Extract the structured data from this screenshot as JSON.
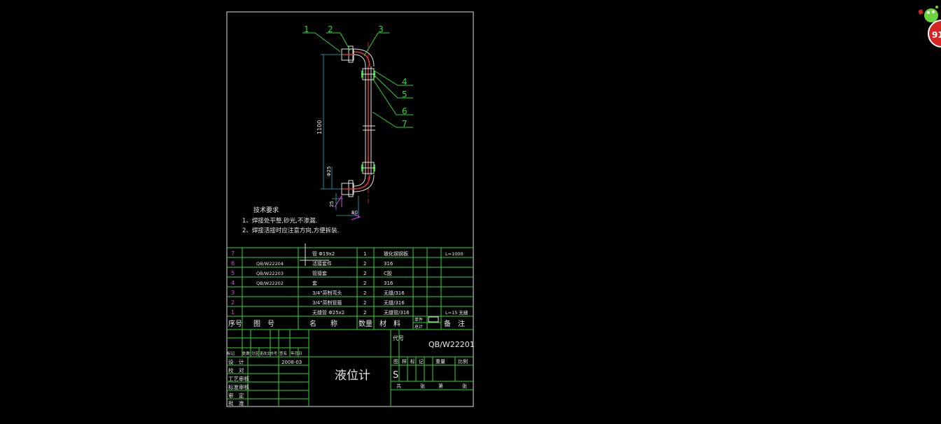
{
  "notes": {
    "title": "技术要求",
    "line1": "1、焊接处平整,砂光,不渗漏.",
    "line2": "2、焊接活接时应注意方向,方便拆装."
  },
  "callouts": [
    "1",
    "2",
    "3",
    "4",
    "5",
    "6",
    "7"
  ],
  "dims": {
    "height": "1100",
    "pipe_dia": "Φ25",
    "small": "25",
    "offset": "80"
  },
  "parts": [
    {
      "no": "7",
      "code": "",
      "name": "管 Φ19x2",
      "qty": "1",
      "material": "玻化钢钢板",
      "remark": "L=1000"
    },
    {
      "no": "6",
      "code": "QB/W22204",
      "name": "活接套件",
      "qty": "2",
      "material": "316",
      "remark": ""
    },
    {
      "no": "5",
      "code": "QB/W22203",
      "name": "管接套",
      "qty": "2",
      "material": "C胶",
      "remark": ""
    },
    {
      "no": "4",
      "code": "QB/W22202",
      "name": "套",
      "qty": "2",
      "material": "316",
      "remark": ""
    },
    {
      "no": "3",
      "code": "",
      "name": "3/4\"英制弯头",
      "qty": "2",
      "material": "无缝/316",
      "remark": ""
    },
    {
      "no": "2",
      "code": "",
      "name": "3/4\"英制管箍",
      "qty": "2",
      "material": "无缝/316",
      "remark": ""
    },
    {
      "no": "1",
      "code": "",
      "name": "无缝管 Φ25x2",
      "qty": "2",
      "material": "无缝管/316",
      "remark": "L=15 无缝"
    }
  ],
  "header": {
    "no": "序号",
    "code": "图　号",
    "name": "名　　称",
    "qty": "数量",
    "material": "材　料",
    "weight_single": "单件",
    "weight_total": "总计",
    "weight": "重量",
    "remark": "备　注"
  },
  "title_block": {
    "drawing_no_label": "代号",
    "drawing_no": "QB/W22201",
    "product_name": "液位计",
    "date": "2008-03",
    "stage_labels": [
      "图",
      "样",
      "标",
      "记"
    ],
    "weight_label": "重量",
    "scale_label": "比例",
    "stage_value": "S",
    "sheet_labels": [
      "共",
      "张",
      "第",
      "张"
    ],
    "revision_labels": [
      "标记",
      "处数",
      "分区",
      "更改文件号",
      "签名",
      "年月日"
    ],
    "sign_rows": [
      "设　计",
      "校　对",
      "工艺审核",
      "标准审核",
      "审　定",
      "批　准"
    ]
  },
  "badge": {
    "text": "91"
  }
}
